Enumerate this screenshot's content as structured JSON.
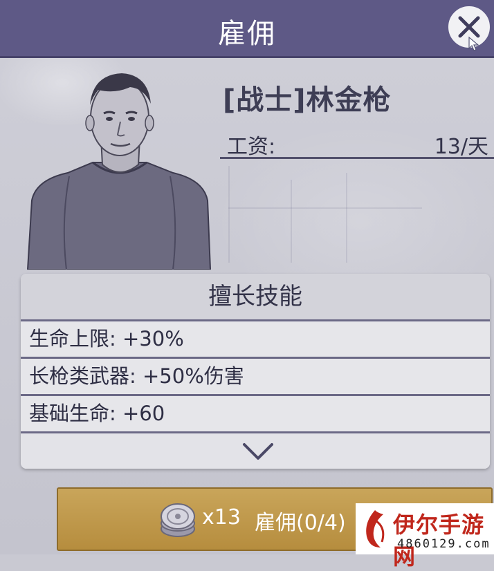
{
  "dialog": {
    "title": "雇佣",
    "close_icon": "close-icon"
  },
  "hero": {
    "name": "[战士]林金枪",
    "salary_label": "工资:",
    "salary_value": "13/天"
  },
  "skills": {
    "header": "擅长技能",
    "items": [
      "生命上限: +30%",
      "长枪类武器: +50%伤害",
      "基础生命: +60"
    ],
    "more_icon": "chevron-down-icon"
  },
  "hire": {
    "coin_icon": "silver-coin-icon",
    "count": "x13",
    "label": "雇佣(0/4)"
  },
  "watermark": {
    "name": "伊尔手游网",
    "url": "4860129.com"
  },
  "colors": {
    "titlebar": "#5e5986",
    "panel": "#e3e3e8",
    "hire_button": "#c29a4c",
    "watermark_red": "#c0271c"
  }
}
